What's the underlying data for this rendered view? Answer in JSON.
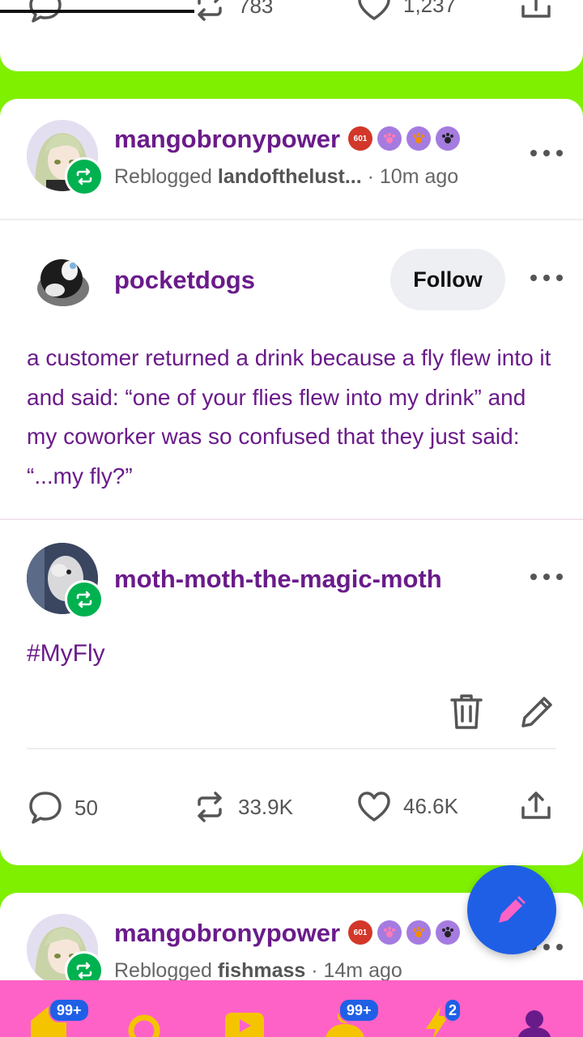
{
  "top_post": {
    "stats": {
      "reblogs": "783",
      "likes": "1,237"
    }
  },
  "main_post": {
    "reblogger": {
      "username": "mangobronypower",
      "badge_text": "601",
      "reblogged_prefix": "Reblogged",
      "reblogged_from": "landofthelust...",
      "time": " · 10m ago"
    },
    "original": {
      "username": "pocketdogs",
      "follow_label": "Follow",
      "text": "a customer returned a drink because a fly flew into it and said: “one of your flies flew into my drink” and my coworker was so confused that they just said: “...my fly?”"
    },
    "reblog": {
      "username": "moth-moth-the-magic-moth",
      "tag": "#MyFly"
    },
    "stats": {
      "comments": "50",
      "reblogs": "33.9K",
      "likes": "46.6K"
    }
  },
  "bottom_post": {
    "reblogger": {
      "username": "mangobronypower",
      "badge_text": "601",
      "reblogged_prefix": "Reblogged",
      "reblogged_from": "fishmass",
      "time": " · 14m ago"
    }
  },
  "navbar": {
    "home_badge": "99+",
    "activity_badge": "99+",
    "lightning_badge": "2"
  },
  "colors": {
    "background": "#7ff000",
    "username": "#6a1b8a",
    "navbar": "#ff62c6",
    "fab": "#1f5fe6",
    "reblog_badge": "#00b14f"
  }
}
